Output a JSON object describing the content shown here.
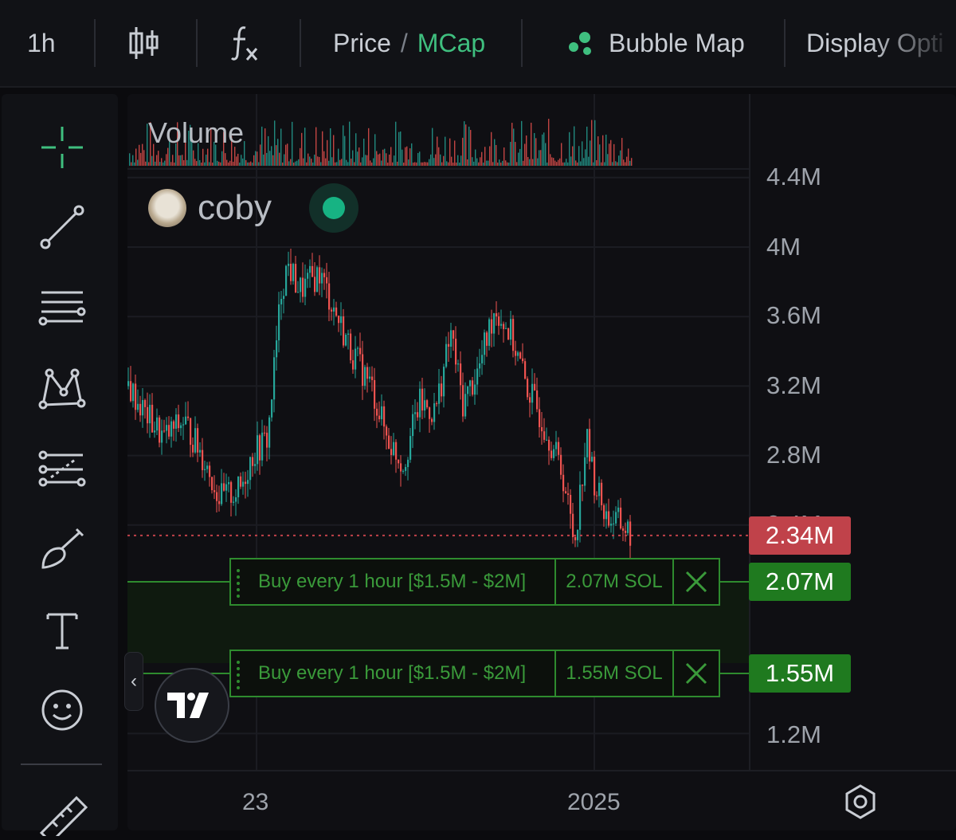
{
  "toolbar": {
    "interval": "1h",
    "candles_icon": "candlestick-icon",
    "fx_icon": "indicators-fx-icon",
    "price_label": "Price",
    "slash": "/",
    "mcap_label": "MCap",
    "bubble_icon": "bubble-map-icon",
    "bubble_label": "Bubble Map",
    "display_label": "Display Opti"
  },
  "left_tools": [
    {
      "name": "crosshair-icon"
    },
    {
      "name": "trend-line-icon"
    },
    {
      "name": "horizontal-lines-icon"
    },
    {
      "name": "pattern-icon"
    },
    {
      "name": "fib-icon"
    },
    {
      "name": "brush-icon"
    },
    {
      "name": "text-tool-icon"
    },
    {
      "name": "emoji-icon"
    },
    {
      "name": "ruler-icon"
    }
  ],
  "chart": {
    "volume_label": "Volume",
    "token_name": "coby",
    "y_ticks": [
      "4.4M",
      "4M",
      "3.6M",
      "3.2M",
      "2.8M",
      "2.4M",
      "1.2M"
    ],
    "x_ticks": [
      "23",
      "2025"
    ],
    "current_price": "2.34M",
    "colors": {
      "up": "#26a69a",
      "down": "#ef5350",
      "order": "#2e8b2e",
      "badge_green": "#1f7a1f",
      "badge_red": "#c0424a"
    }
  },
  "orders": [
    {
      "label": "Buy every 1 hour [$1.5M - $2M]",
      "amount": "2.07M SOL",
      "badge": "2.07M",
      "price": 2.07
    },
    {
      "label": "Buy every 1 hour [$1.5M - $2M]",
      "amount": "1.55M SOL",
      "badge": "1.55M",
      "price": 1.55
    }
  ],
  "chart_data": {
    "type": "candlestick",
    "series_name": "coby",
    "unit": "market cap (USD)",
    "y_scale": {
      "min": 1.0,
      "max": 4.4
    },
    "x_labels": [
      "23",
      "2025"
    ],
    "last_value": 2.34,
    "path_points": [
      [
        0,
        3.2
      ],
      [
        20,
        3.05
      ],
      [
        45,
        2.9
      ],
      [
        70,
        3.0
      ],
      [
        95,
        2.78
      ],
      [
        115,
        2.55
      ],
      [
        140,
        2.6
      ],
      [
        155,
        2.8
      ],
      [
        175,
        2.9
      ],
      [
        185,
        3.4
      ],
      [
        192,
        3.75
      ],
      [
        200,
        3.9
      ],
      [
        215,
        3.75
      ],
      [
        240,
        3.85
      ],
      [
        262,
        3.6
      ],
      [
        280,
        3.4
      ],
      [
        305,
        3.2
      ],
      [
        325,
        2.9
      ],
      [
        345,
        2.75
      ],
      [
        365,
        3.1
      ],
      [
        385,
        3.05
      ],
      [
        405,
        3.5
      ],
      [
        420,
        3.1
      ],
      [
        440,
        3.3
      ],
      [
        460,
        3.65
      ],
      [
        480,
        3.5
      ],
      [
        500,
        3.2
      ],
      [
        525,
        2.95
      ],
      [
        545,
        2.7
      ],
      [
        560,
        2.3
      ],
      [
        575,
        2.9
      ],
      [
        585,
        2.65
      ],
      [
        600,
        2.45
      ],
      [
        620,
        2.4
      ],
      [
        632,
        2.34
      ]
    ]
  }
}
